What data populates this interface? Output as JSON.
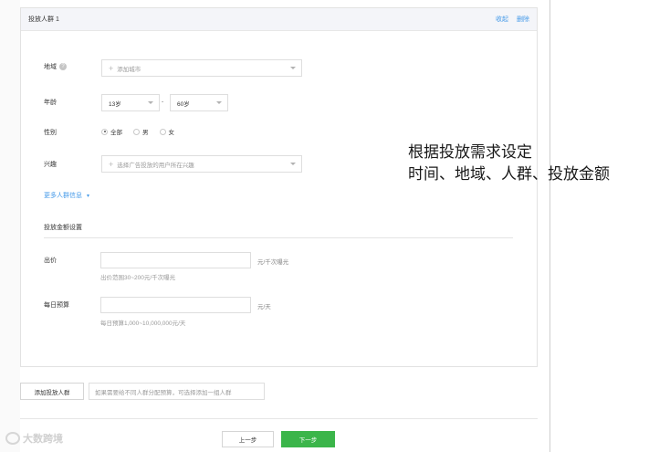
{
  "panel": {
    "title": "投放人群 1",
    "actions": {
      "collapse": "收起",
      "delete": "删除"
    }
  },
  "region": {
    "label": "地域",
    "help_icon": "?",
    "placeholder": "添加城市"
  },
  "age": {
    "label": "年龄",
    "from": "13岁",
    "separator": "-",
    "to": "60岁"
  },
  "gender": {
    "label": "性别",
    "options": [
      {
        "label": "全部",
        "checked": true
      },
      {
        "label": "男",
        "checked": false
      },
      {
        "label": "女",
        "checked": false
      }
    ]
  },
  "interest": {
    "label": "兴趣",
    "placeholder": "选择广告投放的用户所在兴趣"
  },
  "more_link": {
    "label": "更多人群信息"
  },
  "budget_section": {
    "title": "投放金额设置",
    "bid": {
      "label": "出价",
      "unit": "元/千次曝光",
      "hint": "出价范围30~200元/千次曝光"
    },
    "daily_budget": {
      "label": "每日预算",
      "unit": "元/天",
      "hint": "每日预算1,000~10,000,000元/天"
    }
  },
  "add_group": {
    "button": "添加投放人群",
    "hint": "如果需要给不同人群分配预算，可选择添加一组人群"
  },
  "footer": {
    "prev": "上一步",
    "next": "下一步"
  },
  "note": {
    "line1": "根据投放需求设定",
    "line2": "时间、地域、人群、投放金额"
  },
  "watermark": {
    "text": "大数跨境"
  },
  "colors": {
    "link": "#459ae9",
    "primary_button": "#3bb54a"
  }
}
